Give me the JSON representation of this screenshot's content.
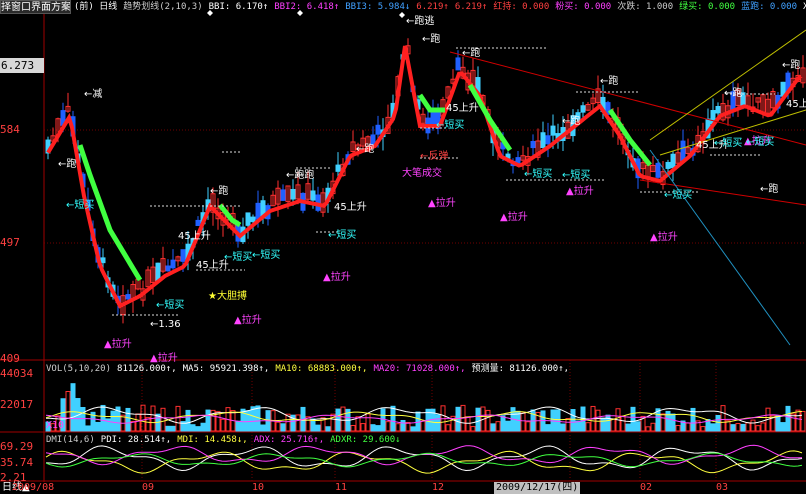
{
  "toolbar": {
    "select_window_label": "择窗口界面方案"
  },
  "main_header": [
    {
      "text": "(前) 日线",
      "color": "#ffffff"
    },
    {
      "text": "趋势划线(2,10,3)",
      "color": "#cccccc"
    },
    {
      "text": "BBI: 6.170↑",
      "color": "#ffffff"
    },
    {
      "text": "BBI2: 6.418↑",
      "color": "#ff40ff"
    },
    {
      "text": "BBI3: 5.984↓",
      "color": "#40a0ff"
    },
    {
      "text": "6.219↑",
      "color": "#ff4040"
    },
    {
      "text": "6.219↑",
      "color": "#ff4040"
    },
    {
      "text": "红持: 0.000",
      "color": "#ff4040"
    },
    {
      "text": "粉买: 0.000",
      "color": "#ff40ff"
    },
    {
      "text": "次跌: 1.000",
      "color": "#cccccc"
    },
    {
      "text": "绿买: 0.000",
      "color": "#40ff40"
    },
    {
      "text": "蓝跑: 0.000",
      "color": "#40a0ff"
    },
    {
      "text": "XXX2: 6",
      "color": "#ffffff"
    }
  ],
  "price_axis": {
    "current": "6.273",
    "labels": [
      "584",
      "497",
      "409"
    ]
  },
  "volume": {
    "header": [
      {
        "text": "VOL(5,10,20)",
        "color": "#cccccc"
      },
      {
        "text": "81126.000↑,",
        "color": "#ffffff"
      },
      {
        "text": "MA5: 95921.398↑,",
        "color": "#ffffff"
      },
      {
        "text": "MA10: 68883.000↑,",
        "color": "#ffff40"
      },
      {
        "text": "MA20: 71028.000↑,",
        "color": "#ff40ff"
      },
      {
        "text": "预测量: 81126.000↑,",
        "color": "#ffffff"
      }
    ],
    "axis": [
      "44034",
      "22017"
    ],
    "unit": "X10"
  },
  "dmi": {
    "header": [
      {
        "text": "DMI(14,6)",
        "color": "#cccccc"
      },
      {
        "text": "PDI: 28.514↑,",
        "color": "#ffffff"
      },
      {
        "text": "MDI: 14.458↓,",
        "color": "#ffff40"
      },
      {
        "text": "ADX: 25.716↑,",
        "color": "#ff40ff"
      },
      {
        "text": "ADXR: 29.600↓",
        "color": "#40ff40"
      }
    ],
    "axis": [
      "69.29",
      "35.74",
      "2.21"
    ]
  },
  "annotations": [
    {
      "text": "←减",
      "color": "#ffffff"
    },
    {
      "text": "←跑",
      "color": "#ffffff"
    },
    {
      "text": "←短买",
      "color": "#3ff"
    },
    {
      "text": "←跑",
      "color": "#ffffff"
    },
    {
      "text": "←跑",
      "color": "#ffffff"
    },
    {
      "text": "45上升",
      "color": "#ffffff"
    },
    {
      "text": "←短买",
      "color": "#3ff"
    },
    {
      "text": "45上升",
      "color": "#ffffff"
    },
    {
      "text": "←短买",
      "color": "#3ff"
    },
    {
      "text": "←短买",
      "color": "#3ff"
    },
    {
      "text": "★大胆搏",
      "color": "#ff3"
    },
    {
      "text": "←1.36",
      "color": "#ffffff"
    },
    {
      "text": "▲拉升",
      "color": "#f4f"
    },
    {
      "text": "▲拉升",
      "color": "#f4f"
    },
    {
      "text": "▲拉升",
      "color": "#f4f"
    },
    {
      "text": "▲拉升",
      "color": "#f4f"
    },
    {
      "text": "←跑",
      "color": "#ffffff"
    },
    {
      "text": "45上升",
      "color": "#ffffff"
    },
    {
      "text": "←短买",
      "color": "#3ff"
    },
    {
      "text": "←跑",
      "color": "#ffffff"
    },
    {
      "text": "←跑逃",
      "color": "#ffffff"
    },
    {
      "text": "←跑",
      "color": "#ffffff"
    },
    {
      "text": "←跑",
      "color": "#ffffff"
    },
    {
      "text": "45上升",
      "color": "#ffffff"
    },
    {
      "text": "←短买",
      "color": "#3ff"
    },
    {
      "text": "←反弹",
      "color": "#f44"
    },
    {
      "text": "大笔成交",
      "color": "#f4f"
    },
    {
      "text": "▲拉升",
      "color": "#f4f"
    },
    {
      "text": "▲拉升",
      "color": "#f4f"
    },
    {
      "text": "←短买",
      "color": "#3ff"
    },
    {
      "text": "←跑",
      "color": "#ffffff"
    },
    {
      "text": "←短买",
      "color": "#3ff"
    },
    {
      "text": "▲拉升",
      "color": "#f4f"
    },
    {
      "text": "←跑",
      "color": "#ffffff"
    },
    {
      "text": "▲拉升",
      "color": "#f4f"
    },
    {
      "text": "←短买",
      "color": "#3ff"
    },
    {
      "text": "←跑",
      "color": "#ffffff"
    },
    {
      "text": "45上升",
      "color": "#ffffff"
    },
    {
      "text": "←短买",
      "color": "#3ff"
    },
    {
      "text": "45上升",
      "color": "#ffffff"
    },
    {
      "text": "←跑",
      "color": "#ffffff"
    },
    {
      "text": "←跑",
      "color": "#ffffff"
    },
    {
      "text": "▲拉升",
      "color": "#f4f"
    },
    {
      "text": "←短买",
      "color": "#3ff"
    }
  ],
  "time_axis": {
    "tab": "日线▲",
    "labels": [
      "2009/08",
      "09",
      "10",
      "11",
      "12",
      "02",
      "03"
    ],
    "selected_date": "2009/12/17(四)"
  }
}
